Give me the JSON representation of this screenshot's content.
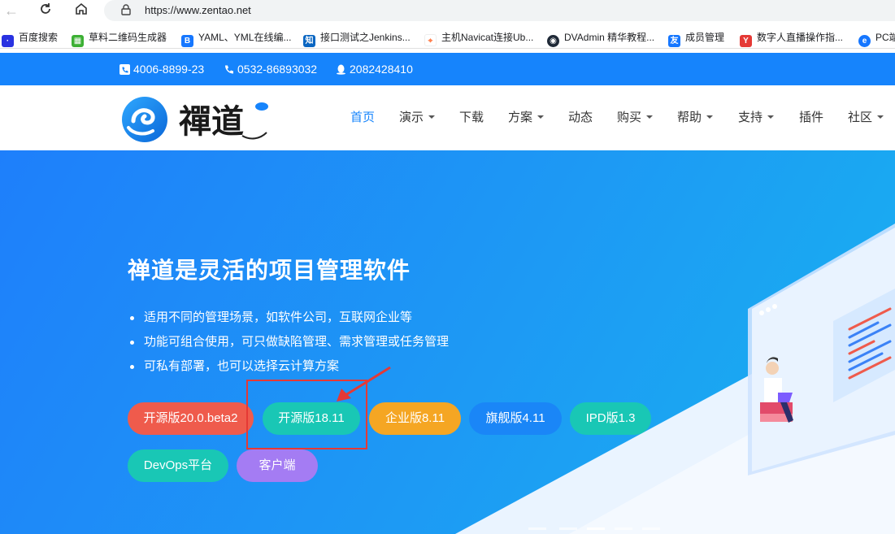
{
  "browser": {
    "url": "https://www.zentao.net",
    "bookmarks": [
      {
        "label": "百度搜索",
        "icon": "baidu-paw-icon",
        "color": "#2932e1"
      },
      {
        "label": "草料二维码生成器",
        "icon": "qr-code-icon",
        "color": "#3cb034"
      },
      {
        "label": "YAML、YML在线编...",
        "icon": "b-icon",
        "color": "#1677ff"
      },
      {
        "label": "接口测试之Jenkins...",
        "icon": "zhihu-icon",
        "color": "#0a66c2"
      },
      {
        "label": "主机Navicat连接Ub...",
        "icon": "pin-icon",
        "color": "#ff7a45"
      },
      {
        "label": "DVAdmin 精华教程...",
        "icon": "dvadmin-icon",
        "color": "#1f2937"
      },
      {
        "label": "成员管理",
        "icon": "member-icon",
        "color": "#1677ff"
      },
      {
        "label": "数字人直播操作指...",
        "icon": "live-icon",
        "color": "#e53935"
      },
      {
        "label": "PC端",
        "icon": "globe-icon",
        "color": "#1677ff"
      }
    ]
  },
  "contact": {
    "hotline": "4006-8899-23",
    "phone": "0532-86893032",
    "qq": "2082428410"
  },
  "nav": [
    {
      "label": "首页",
      "dropdown": false,
      "active": true
    },
    {
      "label": "演示",
      "dropdown": true
    },
    {
      "label": "下载",
      "dropdown": false
    },
    {
      "label": "方案",
      "dropdown": true
    },
    {
      "label": "动态",
      "dropdown": false
    },
    {
      "label": "购买",
      "dropdown": true
    },
    {
      "label": "帮助",
      "dropdown": true
    },
    {
      "label": "支持",
      "dropdown": true
    },
    {
      "label": "插件",
      "dropdown": false
    },
    {
      "label": "社区",
      "dropdown": true
    }
  ],
  "hero": {
    "title": "禅道是灵活的项目管理软件",
    "bullets": [
      "适用不同的管理场景，如软件公司，互联网企业等",
      "功能可组合使用，可只做缺陷管理、需求管理或任务管理",
      "可私有部署，也可以选择云计算方案"
    ],
    "buttons": [
      {
        "label": "开源版20.0.beta2",
        "color": "#ef5b4c"
      },
      {
        "label": "开源版18.11",
        "color": "#19c7b5"
      },
      {
        "label": "企业版8.11",
        "color": "#f5a623"
      },
      {
        "label": "旗舰版4.11",
        "color": "#1a86f7"
      },
      {
        "label": "IPD版1.3",
        "color": "#19c7b5"
      },
      {
        "label": "DevOps平台",
        "color": "#19c7b5"
      },
      {
        "label": "客户端",
        "color": "#a47cf3"
      }
    ]
  },
  "colors": {
    "brand": "#1684fc",
    "highlight": "#e53935"
  }
}
